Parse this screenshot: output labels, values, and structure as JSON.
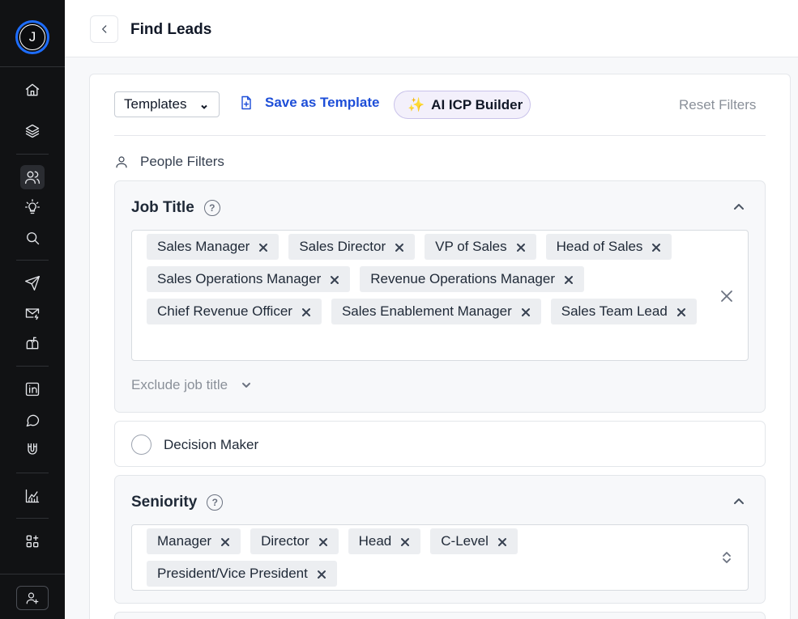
{
  "sidebar": {
    "logo_letter": "J",
    "icons": [
      "home-icon",
      "layers-icon",
      "users-icon",
      "lightbulb-icon",
      "search-icon",
      "send-icon",
      "mail-sync-icon",
      "mailbox-icon",
      "linkedin-icon",
      "chat-icon",
      "magnet-icon",
      "analytics-icon",
      "apps-icon",
      "user-add-icon"
    ],
    "active": "users-icon"
  },
  "header": {
    "title": "Find Leads"
  },
  "toolbar": {
    "templates_label": "Templates",
    "save_template_label": "Save as Template",
    "ai_builder_label": "AI ICP Builder",
    "reset_label": "Reset Filters"
  },
  "people_filters": {
    "label": "People Filters"
  },
  "job_title": {
    "title": "Job Title",
    "help": "?",
    "tags": [
      "Sales Manager",
      "Sales Director",
      "VP of Sales",
      "Head of Sales",
      "Sales Operations Manager",
      "Revenue Operations Manager",
      "Chief Revenue Officer",
      "Sales Enablement Manager",
      "Sales Team Lead"
    ],
    "exclude_label": "Exclude job title"
  },
  "decision_maker": {
    "label": "Decision Maker"
  },
  "seniority": {
    "title": "Seniority",
    "help": "?",
    "tags": [
      "Manager",
      "Director",
      "Head",
      "C-Level",
      "President/Vice President"
    ]
  },
  "colors": {
    "sidebar_bg": "#111214",
    "accent_blue": "#1d4ed8",
    "logo_ring": "#1d6dff",
    "ai_button_bg": "#f3f0fb"
  }
}
